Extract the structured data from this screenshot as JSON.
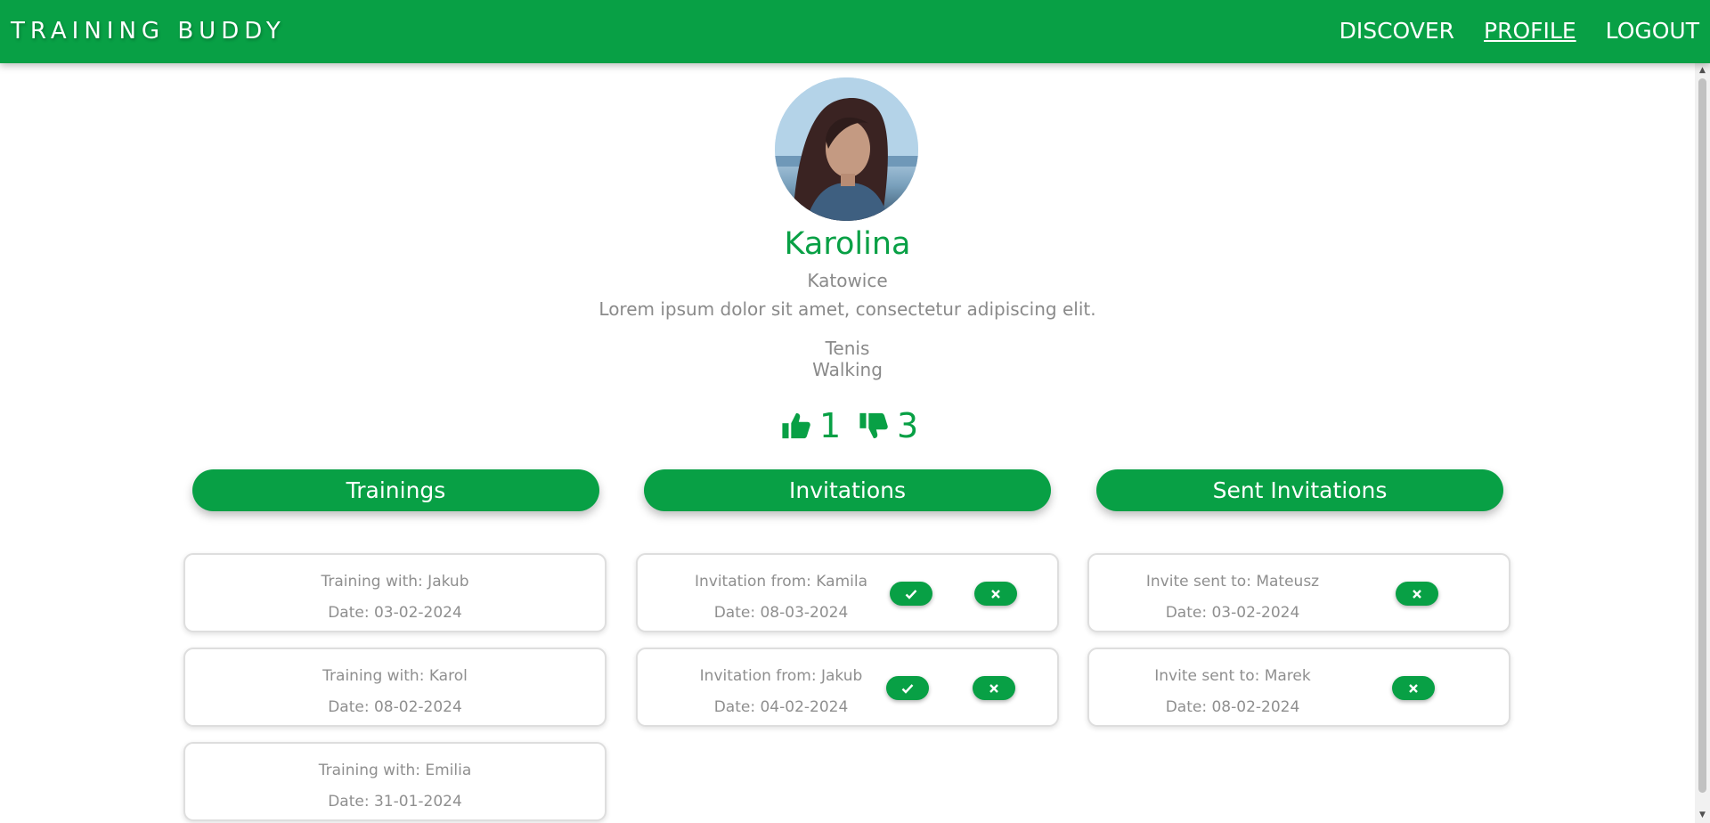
{
  "nav": {
    "brand": "TRAINING BUDDY",
    "links": [
      "DISCOVER",
      "PROFILE",
      "LOGOUT"
    ],
    "active": "PROFILE"
  },
  "profile": {
    "name": "Karolina",
    "city": "Katowice",
    "bio": "Lorem ipsum dolor sit amet, consectetur adipiscing elit.",
    "sports": [
      "Tenis",
      "Walking"
    ],
    "likes": "1",
    "dislikes": "3"
  },
  "sections": [
    "Trainings",
    "Invitations",
    "Sent Invitations"
  ],
  "trainings": [
    {
      "with": "Training with: Jakub",
      "date": "Date: 03-02-2024"
    },
    {
      "with": "Training with: Karol",
      "date": "Date: 08-02-2024"
    },
    {
      "with": "Training with: Emilia",
      "date": "Date: 31-01-2024"
    }
  ],
  "invitations": [
    {
      "from": "Invitation from: Kamila",
      "date": "Date: 08-03-2024"
    },
    {
      "from": "Invitation from: Jakub",
      "date": "Date: 04-02-2024"
    }
  ],
  "sent_invitations": [
    {
      "to": "Invite sent to: Mateusz",
      "date": "Date: 03-02-2024"
    },
    {
      "to": "Invite sent to: Marek",
      "date": "Date: 08-02-2024"
    }
  ],
  "colors": {
    "accent": "#08a045",
    "muted_text": "#8f8f8f",
    "card_border": "#dedede"
  },
  "icons": [
    "thumbs-up-icon",
    "thumbs-down-icon",
    "check-icon",
    "close-icon",
    "scroll-up-arrow-icon",
    "scroll-down-arrow-icon"
  ]
}
